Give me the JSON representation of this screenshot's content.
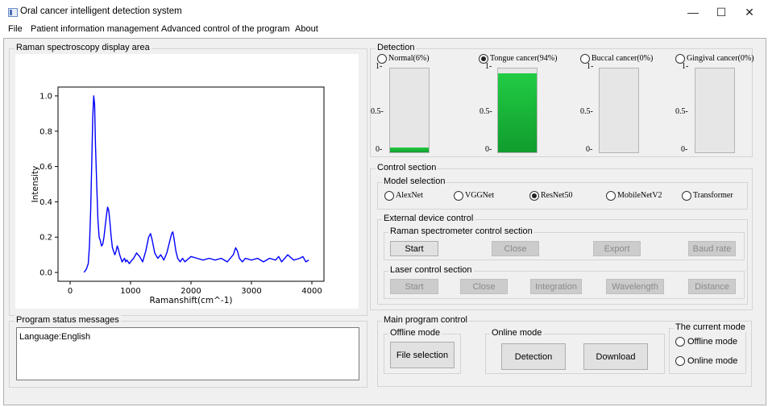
{
  "window": {
    "title": "Oral cancer intelligent detection system",
    "minimize": "—",
    "maximize": "☐",
    "close": "✕"
  },
  "menu": [
    "File",
    "Patient information management",
    "Advanced control of the program",
    "About"
  ],
  "raman_group_title": "Raman spectroscopy display area",
  "chart_data": {
    "type": "line",
    "xlabel": "Ramanshift(cm^-1)",
    "ylabel": "Intensity",
    "xlim": [
      -200,
      4200
    ],
    "ylim": [
      -0.05,
      1.05
    ],
    "x_ticks": [
      "0",
      "1000",
      "2000",
      "3000",
      "4000"
    ],
    "y_ticks": [
      "0.0",
      "0.2",
      "0.4",
      "0.6",
      "0.8",
      "1.0"
    ],
    "series": [
      {
        "color": "#0000ff",
        "x": [
          230,
          270,
          300,
          320,
          340,
          360,
          375,
          390,
          405,
          420,
          440,
          460,
          480,
          500,
          520,
          540,
          560,
          580,
          600,
          620,
          640,
          660,
          680,
          700,
          720,
          740,
          760,
          780,
          800,
          820,
          840,
          860,
          880,
          900,
          920,
          940,
          960,
          980,
          1000,
          1050,
          1100,
          1150,
          1200,
          1250,
          1300,
          1330,
          1360,
          1400,
          1450,
          1500,
          1550,
          1600,
          1650,
          1680,
          1700,
          1720,
          1750,
          1780,
          1820,
          1860,
          1900,
          2000,
          2100,
          2200,
          2300,
          2400,
          2500,
          2600,
          2700,
          2740,
          2770,
          2800,
          2850,
          2900,
          3000,
          3100,
          3200,
          3300,
          3400,
          3450,
          3500,
          3550,
          3600,
          3700,
          3800,
          3850,
          3900,
          3950
        ],
        "y": [
          0.0,
          0.02,
          0.05,
          0.15,
          0.35,
          0.65,
          0.88,
          1.0,
          0.95,
          0.72,
          0.5,
          0.3,
          0.2,
          0.18,
          0.15,
          0.16,
          0.2,
          0.26,
          0.32,
          0.37,
          0.35,
          0.28,
          0.2,
          0.14,
          0.12,
          0.1,
          0.12,
          0.15,
          0.13,
          0.1,
          0.08,
          0.06,
          0.07,
          0.08,
          0.06,
          0.07,
          0.06,
          0.05,
          0.06,
          0.08,
          0.11,
          0.09,
          0.06,
          0.12,
          0.2,
          0.22,
          0.18,
          0.11,
          0.08,
          0.1,
          0.07,
          0.11,
          0.18,
          0.22,
          0.23,
          0.19,
          0.12,
          0.08,
          0.06,
          0.08,
          0.06,
          0.09,
          0.08,
          0.07,
          0.08,
          0.07,
          0.08,
          0.06,
          0.1,
          0.14,
          0.12,
          0.08,
          0.06,
          0.08,
          0.07,
          0.08,
          0.06,
          0.08,
          0.07,
          0.09,
          0.06,
          0.08,
          0.1,
          0.07,
          0.08,
          0.09,
          0.06,
          0.07
        ]
      }
    ]
  },
  "status_group_title": "Program status messages",
  "status_text": "Language:English",
  "detection": {
    "title": "Detection",
    "top_tick": "1-",
    "mid_tick": "0.5-",
    "bottom_tick": "0-",
    "classes": [
      {
        "label": "Normal(6%)",
        "value": 0.06,
        "checked": false
      },
      {
        "label": "Tongue cancer(94%)",
        "value": 0.94,
        "checked": true
      },
      {
        "label": "Buccal cancer(0%)",
        "value": 0.0,
        "checked": false
      },
      {
        "label": "Gingival cancer(0%)",
        "value": 0.0,
        "checked": false
      }
    ]
  },
  "control": {
    "title": "Control section",
    "model_title": "Model selection",
    "models": [
      {
        "label": "AlexNet",
        "checked": false
      },
      {
        "label": "VGGNet",
        "checked": false
      },
      {
        "label": "ResNet50",
        "checked": true
      },
      {
        "label": "MobileNetV2",
        "checked": false
      },
      {
        "label": "Transformer",
        "checked": false
      }
    ],
    "external_title": "External device control",
    "raman_title": "Raman spectrometer control section",
    "raman_buttons": [
      "Start",
      "Close",
      "Export",
      "Baud rate"
    ],
    "laser_title": "Laser control section",
    "laser_buttons": [
      "Start",
      "Close",
      "Integration",
      "Wavelength",
      "Distance"
    ]
  },
  "main_control": {
    "title": "Main program control",
    "offline_title": "Offline mode",
    "file_selection": "File selection",
    "online_title": "Online mode",
    "detection_btn": "Detection",
    "download_btn": "Download",
    "current_mode_title": "The current mode",
    "mode_offline": "Offline mode",
    "mode_online": "Online mode"
  }
}
